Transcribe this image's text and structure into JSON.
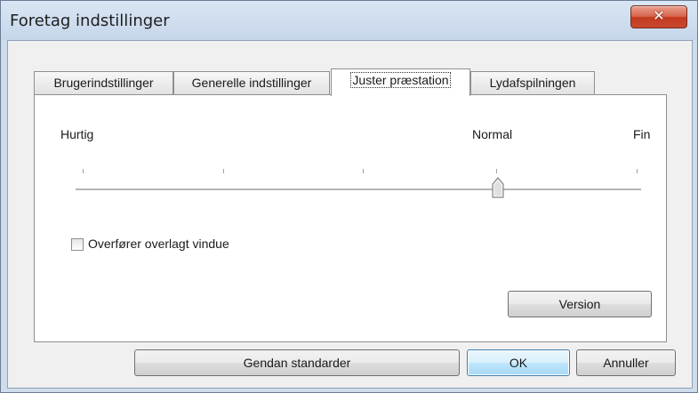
{
  "window": {
    "title": "Foretag indstillinger",
    "close_glyph": "✕"
  },
  "tabs": [
    {
      "label": "Brugerindstillinger",
      "active": false
    },
    {
      "label": "Generelle indstillinger",
      "active": false
    },
    {
      "label": "Juster præstation",
      "active": true
    },
    {
      "label": "Lydafspilningen",
      "active": false
    }
  ],
  "performance": {
    "label_fast": "Hurtig",
    "label_normal": "Normal",
    "label_fine": "Fin",
    "slider_level_fraction": 0.75,
    "slider_tick_count": 5
  },
  "checkbox": {
    "label": "Overfører overlagt vindue",
    "checked": false
  },
  "buttons": {
    "version": "Version",
    "restore_defaults": "Gendan standarder",
    "ok": "OK",
    "cancel": "Annuller"
  },
  "colors": {
    "title_bar": "#c6d6ea",
    "close_button": "#c8492e",
    "primary_button": "#bee6fd"
  }
}
